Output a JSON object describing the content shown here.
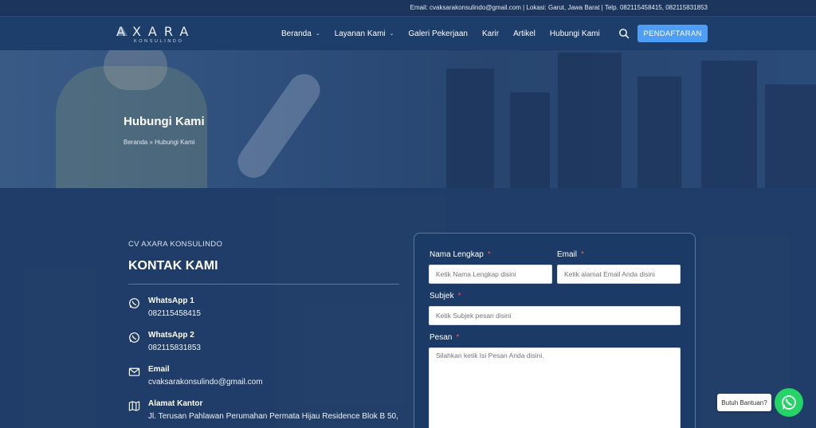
{
  "topbar": {
    "info": "Email: cvaksarakonsulindo@gmail.com | Lokasi: Garut, Jawa Barat | Telp. 082115458415, 082115831853"
  },
  "logo": {
    "brand": "AXARA",
    "sub": "KONSULINDO"
  },
  "nav": {
    "items": [
      {
        "label": "Beranda",
        "dropdown": true
      },
      {
        "label": "Layanan Kami",
        "dropdown": true
      },
      {
        "label": "Galeri Pekerjaan",
        "dropdown": false
      },
      {
        "label": "Karir",
        "dropdown": false
      },
      {
        "label": "Artikel",
        "dropdown": false
      },
      {
        "label": "Hubungi Kami",
        "dropdown": false
      }
    ],
    "cta": "PENDAFTARAN"
  },
  "hero": {
    "title": "Hubungi Kami",
    "breadcrumb": "Beranda » Hubungi Kami"
  },
  "contact": {
    "company": "CV AXARA KONSULINDO",
    "heading": "KONTAK KAMI",
    "items": [
      {
        "icon": "whatsapp-icon",
        "title": "WhatsApp 1",
        "value": "082115458415"
      },
      {
        "icon": "whatsapp-icon",
        "title": "WhatsApp 2",
        "value": "082115831853"
      },
      {
        "icon": "email-icon",
        "title": "Email",
        "value": "cvaksarakonsulindo@gmail.com"
      },
      {
        "icon": "map-icon",
        "title": "Alamat Kantor",
        "value": "Jl. Terusan Pahlawan Perumahan Permata Hijau Residence Blok B 50,"
      }
    ]
  },
  "form": {
    "name_label": "Nama Lengkap",
    "name_placeholder": "Ketik Nama Lengkap disini",
    "email_label": "Email",
    "email_placeholder": "Ketik alamat Email Anda disini",
    "subject_label": "Subjek",
    "subject_placeholder": "Ketik Subjek pesan disini",
    "message_label": "Pesan",
    "message_placeholder": "Silahkan ketik Isi Pesan Anda disini.",
    "required_mark": "*"
  },
  "help": {
    "label": "Butuh Bantuan?"
  },
  "colors": {
    "accent": "#4f9df5",
    "navy": "#1d3d6a",
    "whatsapp": "#25d366",
    "required": "#f05a5a"
  }
}
